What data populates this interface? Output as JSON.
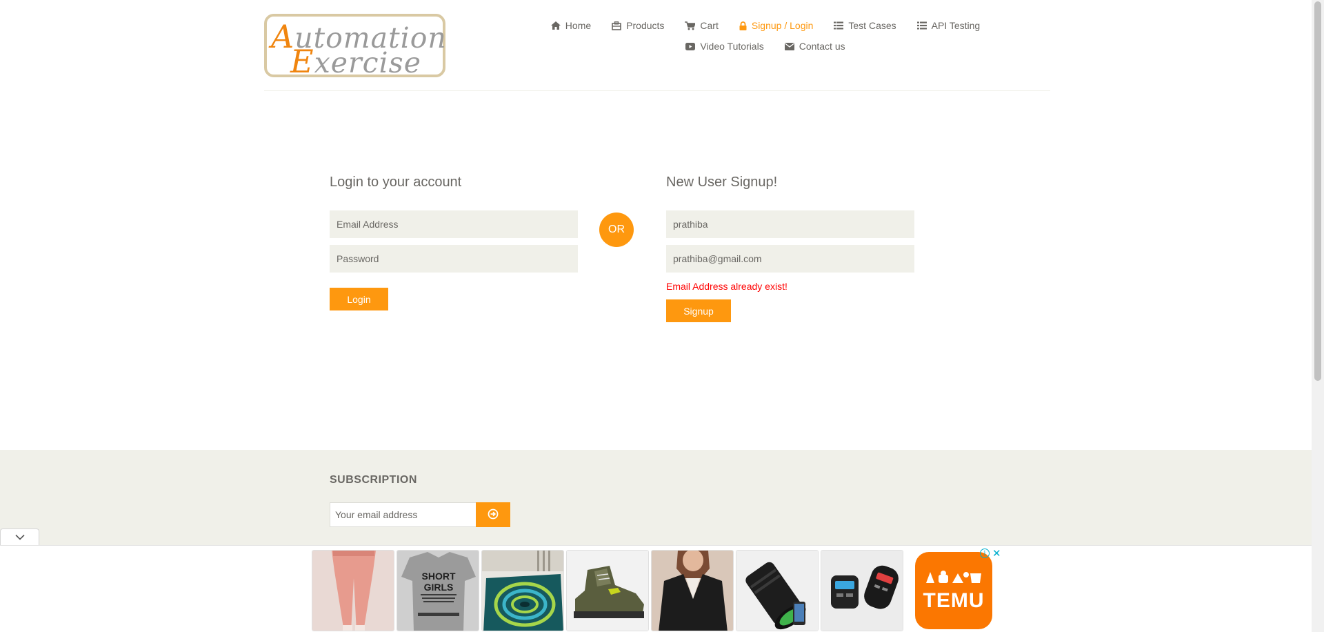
{
  "logo": {
    "line1_first": "A",
    "line1_rest": "utomation",
    "line2_first": "E",
    "line2_rest": "xercise"
  },
  "nav": {
    "row1": [
      {
        "label": "Home",
        "icon": "home-icon"
      },
      {
        "label": "Products",
        "icon": "products-icon"
      },
      {
        "label": "Cart",
        "icon": "cart-icon"
      },
      {
        "label": "Signup / Login",
        "icon": "lock-icon",
        "active": true
      },
      {
        "label": "Test Cases",
        "icon": "list-icon"
      },
      {
        "label": "API Testing",
        "icon": "list-icon"
      }
    ],
    "row2": [
      {
        "label": "Video Tutorials",
        "icon": "youtube-icon"
      },
      {
        "label": "Contact us",
        "icon": "envelope-icon"
      }
    ]
  },
  "login": {
    "title": "Login to your account",
    "email_placeholder": "Email Address",
    "password_placeholder": "Password",
    "button": "Login"
  },
  "or_label": "OR",
  "signup": {
    "title": "New User Signup!",
    "name_value": "prathiba",
    "email_value": "prathiba@gmail.com",
    "error": "Email Address already exist!",
    "button": "Signup"
  },
  "subscription": {
    "title": "SUBSCRIPTION",
    "placeholder": "Your email address"
  },
  "ads": {
    "tiles": [
      {
        "name": "pink-leggings",
        "bg": "#e9d9d4"
      },
      {
        "name": "short-girls-tshirt",
        "bg": "#cfcfcf",
        "text_line1": "SHORT",
        "text_line2": "GIRLS"
      },
      {
        "name": "spiral-rug",
        "bg": "#1d6a6e"
      },
      {
        "name": "hiking-boot",
        "bg": "#f2f2f2"
      },
      {
        "name": "black-blazer",
        "bg": "#d9c7b9"
      },
      {
        "name": "monocular-telescope",
        "bg": "#f0f0f0"
      },
      {
        "name": "car-charger",
        "bg": "#ececec"
      }
    ],
    "brand": "TEMU",
    "brand_color": "#fb7701",
    "info_glyph": "i",
    "close_glyph": "✕"
  },
  "colors": {
    "accent": "#fe980f",
    "text": "#696763",
    "field_bg": "#f0f0e9",
    "error": "#ff0000"
  }
}
